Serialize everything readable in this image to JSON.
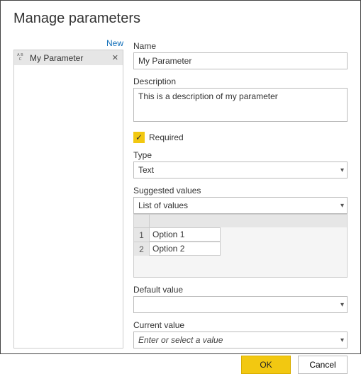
{
  "title": "Manage parameters",
  "sidebar": {
    "new_label": "New",
    "items": [
      {
        "name": "My Parameter"
      }
    ]
  },
  "form": {
    "name_label": "Name",
    "name_value": "My Parameter",
    "description_label": "Description",
    "description_value": "This is a description of my parameter",
    "required_label": "Required",
    "required_checked": true,
    "type_label": "Type",
    "type_value": "Text",
    "suggested_label": "Suggested values",
    "suggested_value": "List of values",
    "list_values": [
      {
        "index": "1",
        "value": "Option 1"
      },
      {
        "index": "2",
        "value": "Option 2"
      }
    ],
    "default_label": "Default value",
    "default_value": "",
    "current_label": "Current value",
    "current_placeholder": "Enter or select a value"
  },
  "footer": {
    "ok_label": "OK",
    "cancel_label": "Cancel"
  }
}
